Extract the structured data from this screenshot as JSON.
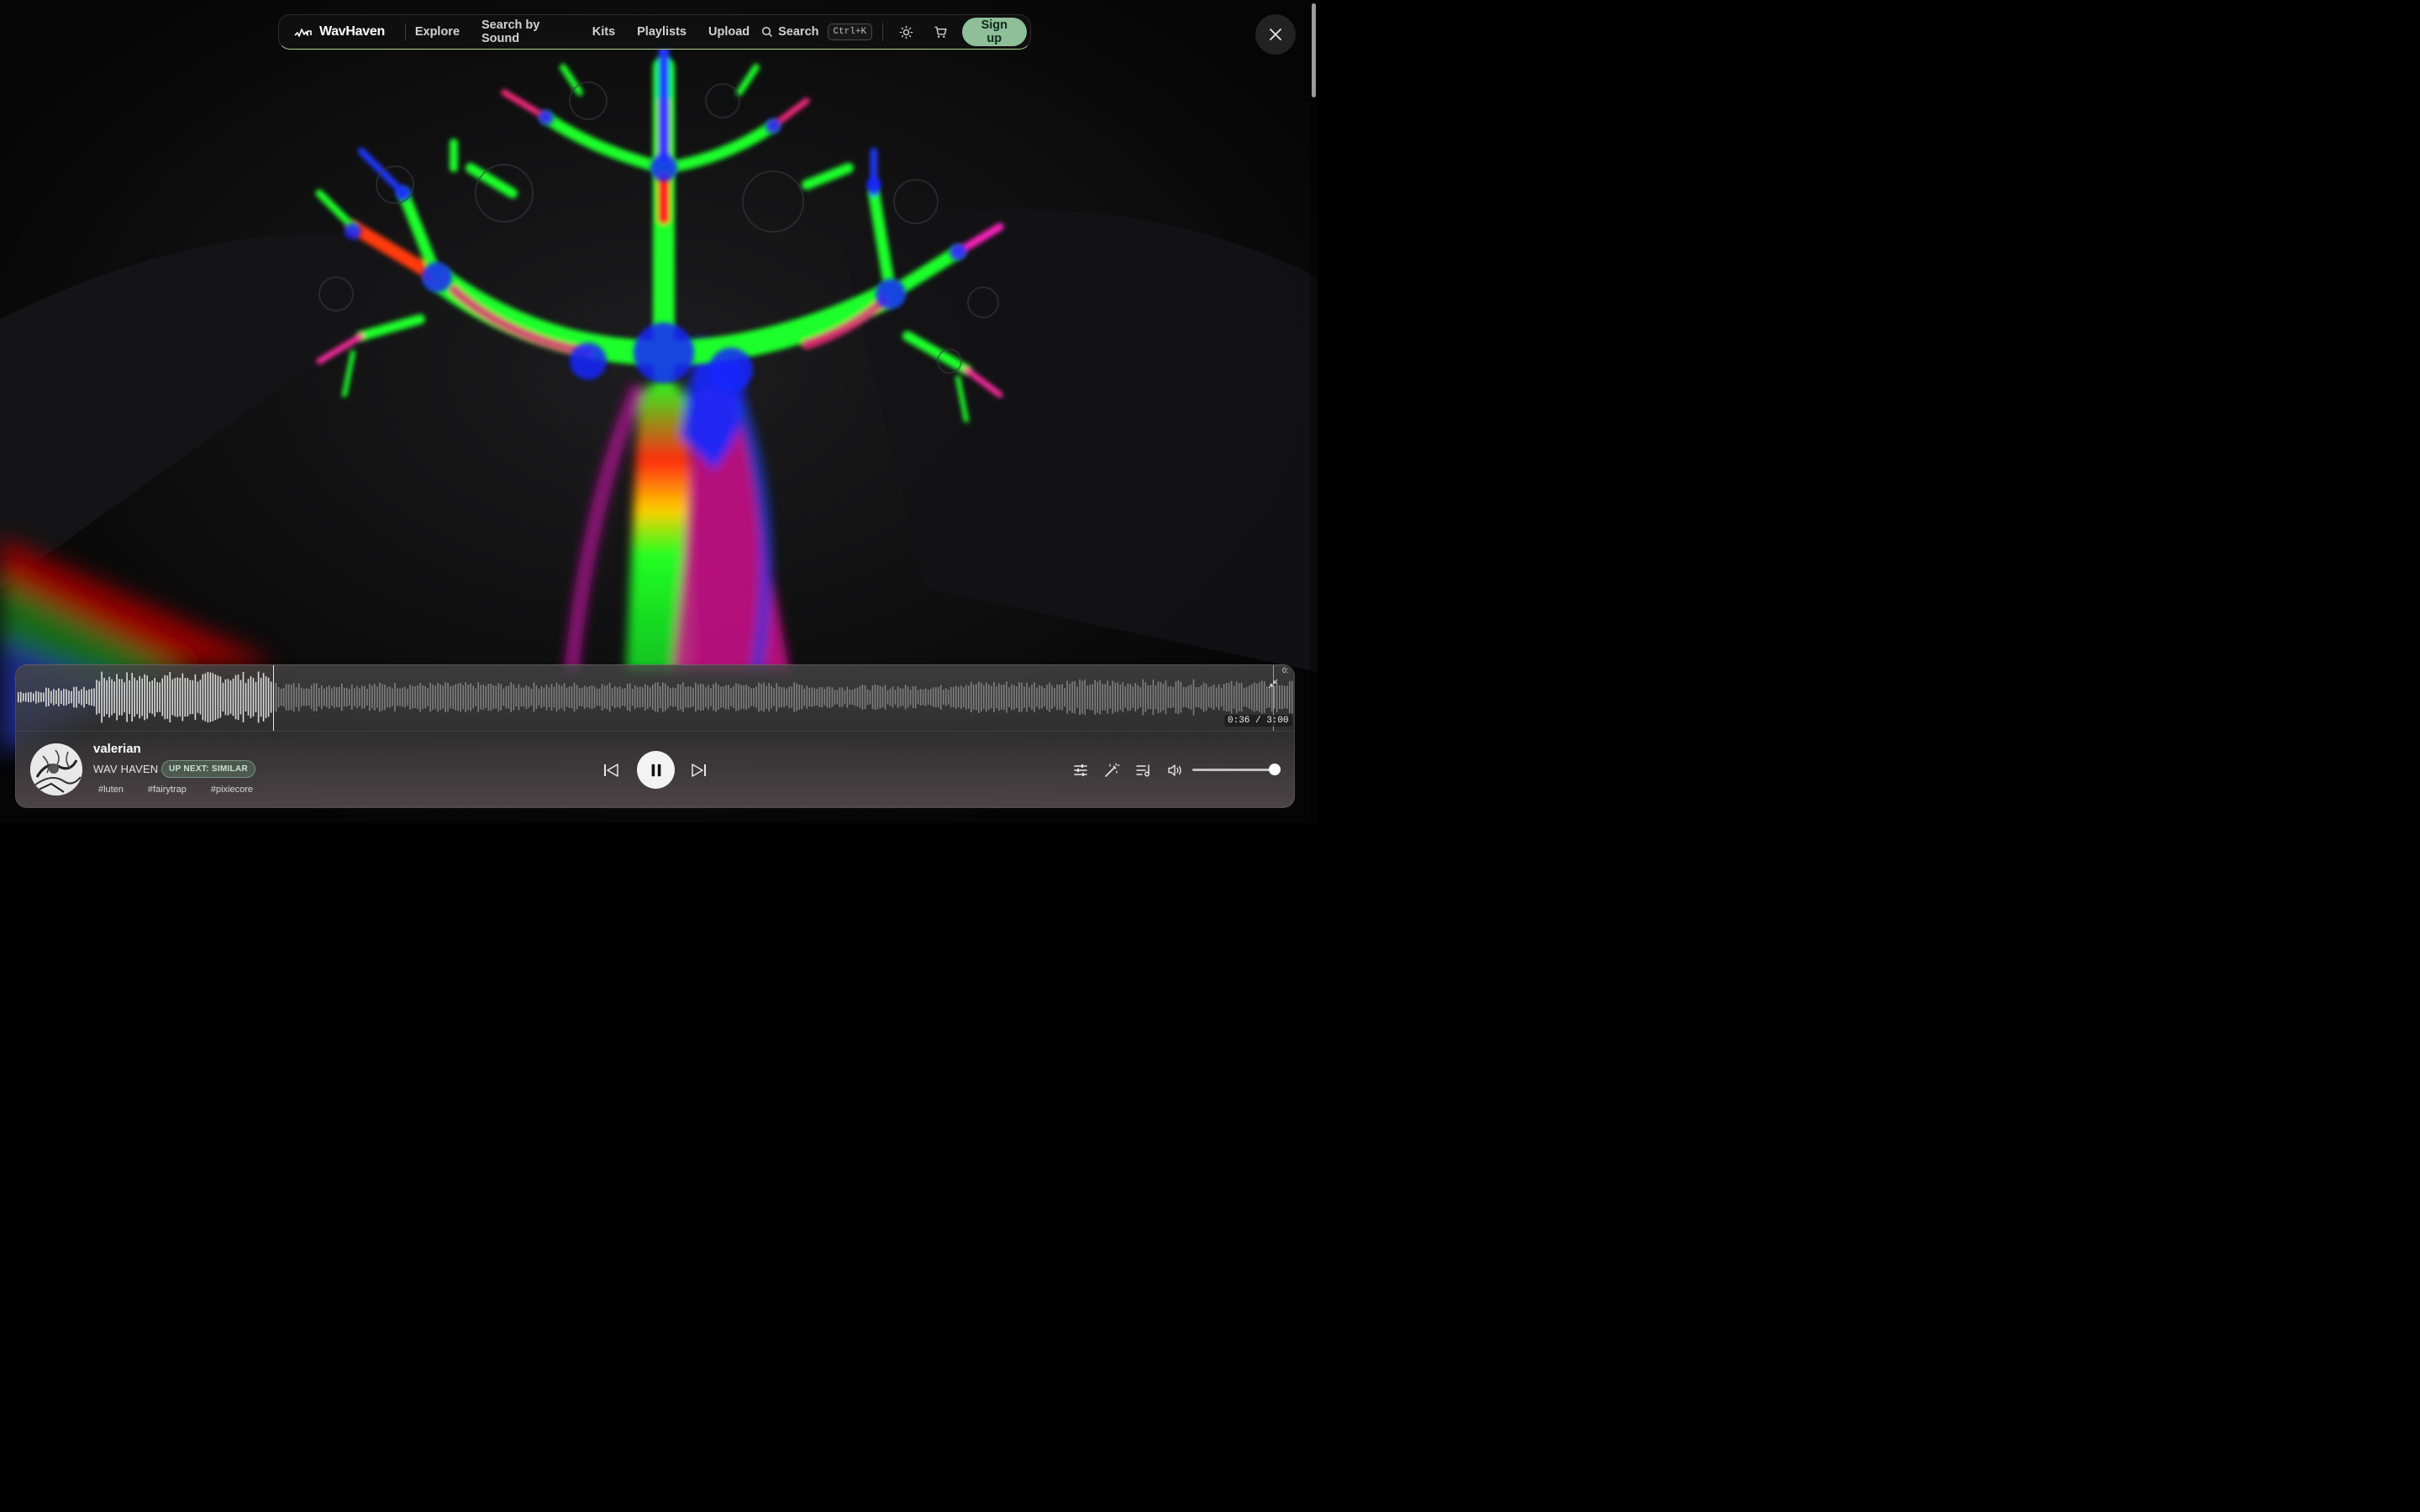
{
  "brand": {
    "name": "WavHaven"
  },
  "nav": {
    "links": [
      "Explore",
      "Search by Sound",
      "Kits",
      "Playlists",
      "Upload"
    ],
    "search_label": "Search",
    "search_shortcut": "Ctrl+K",
    "signup_label": "Sign up",
    "icons": [
      "logo-waveform-icon",
      "search-icon",
      "theme-toggle-sun-icon",
      "cart-icon"
    ]
  },
  "close_icon": "close-icon",
  "player": {
    "track_title": "valerian",
    "artist": "WAV HAVEN",
    "badge": "UP NEXT: SIMILAR",
    "tags": [
      "#luten",
      "#fairytrap",
      "#pixiecore"
    ],
    "time_display": "0:36 / 3:00",
    "progress_fraction": 0.2,
    "volume_fraction": 1.0,
    "edge_label": "0:",
    "controls": [
      "previous-icon",
      "pause-icon",
      "next-icon"
    ],
    "tool_icons": [
      "equalizer-icon",
      "magic-wand-icon",
      "queue-icon",
      "volume-icon"
    ],
    "colors": {
      "accent": "#8ebf98",
      "nav_border": "#b3d28f",
      "badge_bg": "#6e9678"
    }
  }
}
